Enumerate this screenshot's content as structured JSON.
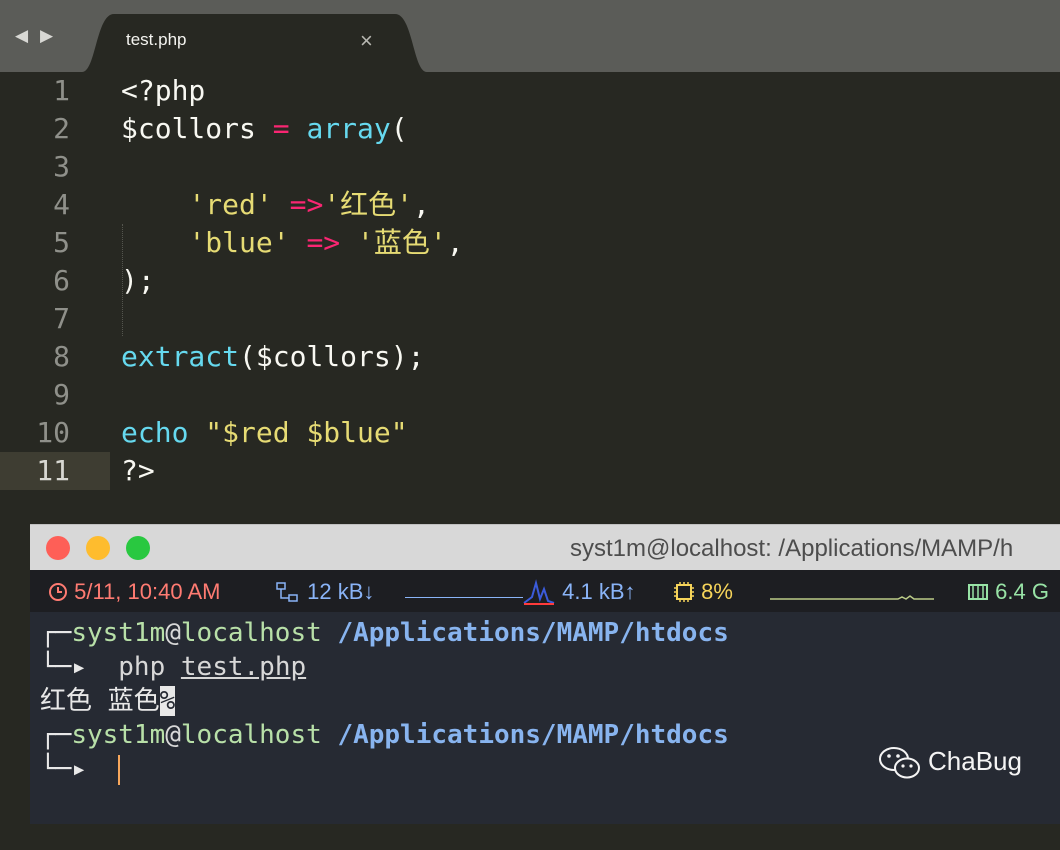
{
  "tabbar": {
    "nav_back": "◀",
    "nav_forward": "▶",
    "tab_title": "test.php",
    "tab_close": "×"
  },
  "editor": {
    "lines": [
      {
        "n": "1",
        "text": "<?php"
      },
      {
        "n": "2",
        "text": "$collors = array("
      },
      {
        "n": "3",
        "text": ""
      },
      {
        "n": "4",
        "text": "    'red' =>'红色',"
      },
      {
        "n": "5",
        "text": "    'blue' => '蓝色',"
      },
      {
        "n": "6",
        "text": ");"
      },
      {
        "n": "7",
        "text": ""
      },
      {
        "n": "8",
        "text": "extract($collors);"
      },
      {
        "n": "9",
        "text": ""
      },
      {
        "n": "10",
        "text": "echo \"$red $blue\""
      },
      {
        "n": "11",
        "text": "?>"
      }
    ],
    "active_line": 11
  },
  "terminal": {
    "title": "syst1m@localhost: /Applications/MAMP/h",
    "status": {
      "time": "5/11, 10:40 AM",
      "net_down": "12 kB↓",
      "net_up": "4.1 kB↑",
      "cpu": "8%",
      "disk": "6.4 G"
    },
    "prompt_user": "syst1m",
    "prompt_at": "@",
    "prompt_host": "localhost",
    "prompt_path": "/Applications/MAMP/htdocs",
    "command_prog": "php",
    "command_arg": "test.php",
    "output": "红色 蓝色",
    "output_marker": "%"
  },
  "watermark": {
    "text": "ChaBug"
  },
  "colors": {
    "keyword": "#f92672",
    "function": "#66d9ef",
    "string": "#e6db74",
    "cursor": "#f7a75c"
  }
}
